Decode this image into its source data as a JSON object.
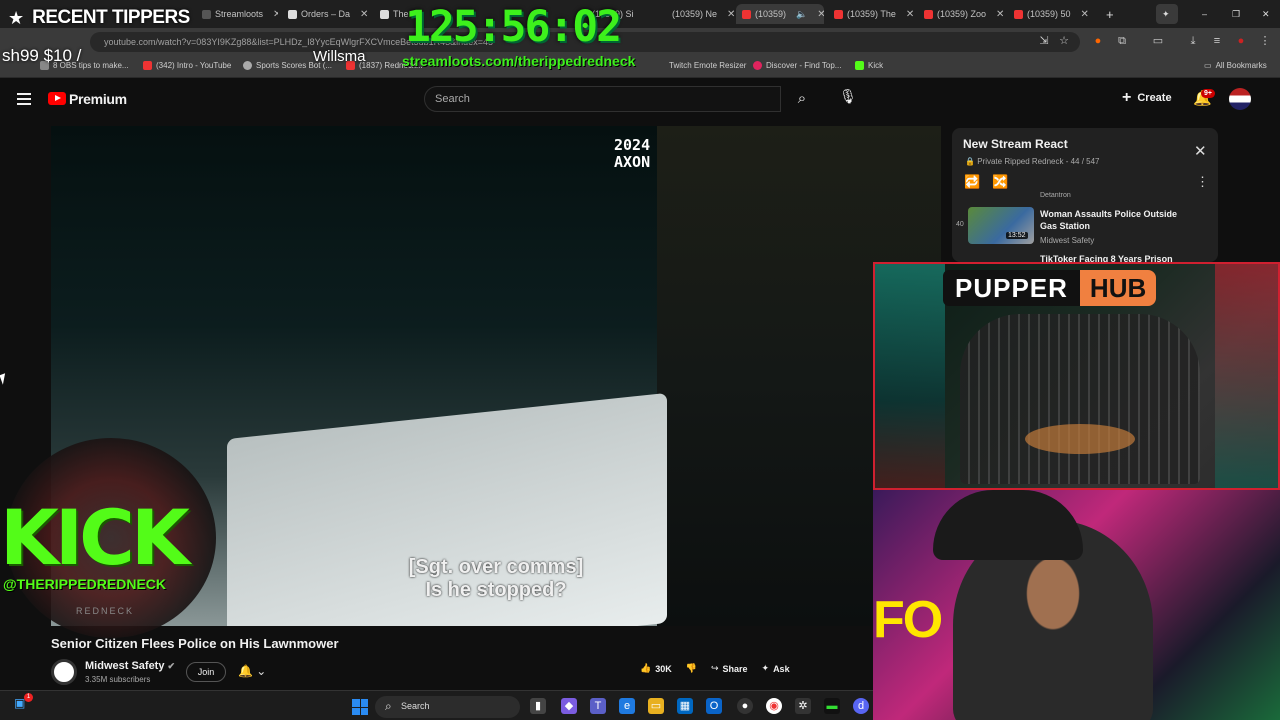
{
  "browser": {
    "tabs": [
      {
        "label": "Streamloots",
        "active": false
      },
      {
        "label": "Orders – Da",
        "active": false
      },
      {
        "label": "The",
        "active": false
      },
      {
        "label": "(10359) Si",
        "active": false
      },
      {
        "label": "(10359) Ne",
        "active": false
      },
      {
        "label": "(10359)",
        "active": true
      },
      {
        "label": "(10359) The",
        "active": false
      },
      {
        "label": "(10359) Zoo",
        "active": false
      },
      {
        "label": "(10359) 50",
        "active": false
      }
    ],
    "url": "youtube.com/watch?v=083YI9KZg88&list=PLHDz_I8YycEqWlgrFXCVmceBet5ub1R43&index=45",
    "bookmarks": [
      "8 OBS tips to make...",
      "(342) Intro - YouTube",
      "Sports Scores Bot (...",
      "(1837) Redneck...",
      "Twitch Emote Resizer",
      "Discover - Find Top...",
      "Kick"
    ],
    "all_bookmarks": "All Bookmarks"
  },
  "youtube": {
    "logo_text": "Premium",
    "search_placeholder": "Search",
    "create_label": "Create",
    "notif_badge": "9+",
    "video": {
      "watermark_year": "2024",
      "watermark_brand": "AXON",
      "caption_line1": "[Sgt. over comms]",
      "caption_line2": "Is he stopped?"
    },
    "video_title": "Senior Citizen Flees Police on His Lawnmower",
    "channel_name": "Midwest Safety",
    "channel_subs": "3.35M subscribers",
    "join_label": "Join",
    "likes": "30K",
    "share_label": "Share",
    "ask_label": "Ask",
    "playlist": {
      "title": "New Stream React",
      "subtitle": "Private Ripped Redneck - 44 / 547",
      "prev_channel": "Detantron",
      "item_number": "40",
      "item_title": "Woman Assaults Police Outside Gas Station",
      "item_duration": "13:52",
      "item_channel": "Midwest Safety",
      "next_title": "TikToker Facing 8 Years Prison"
    }
  },
  "overlay": {
    "recent_tippers": "RECENT TIPPERS",
    "tip_line": "sh99 $10 /",
    "tip_name": "Willsma",
    "timer": "125:56:02",
    "streamloots": "streamloots.com/therippedredneck",
    "kick_logo": "KICK",
    "kick_handle": "@THERIPPEDREDNECK",
    "kick_sub": "REDNECK",
    "pupper_left": "PUPPER",
    "pupper_right": "HUB",
    "cam_text": "FO"
  },
  "taskbar": {
    "search_label": "Search",
    "widget_badge": "1"
  }
}
